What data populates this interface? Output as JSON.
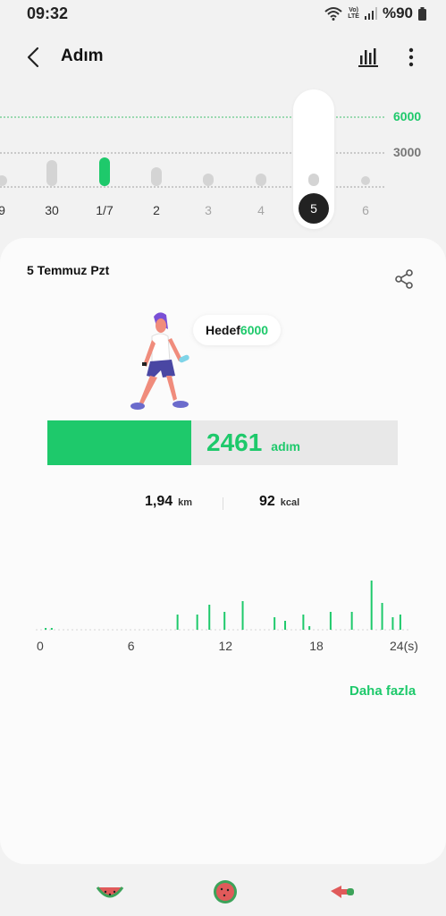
{
  "status": {
    "time": "09:32",
    "volte_top": "Vo)",
    "volte_bottom": "LTE",
    "battery": "%90"
  },
  "header": {
    "title": "Adım",
    "back_icon": "chevron-left-icon",
    "stats_icon": "bar-chart-icon",
    "menu_icon": "more-vertical-icon"
  },
  "week_chart": {
    "goal_label": "6000",
    "mid_label": "3000",
    "days": [
      {
        "label": "9",
        "steps": 900,
        "state": "past"
      },
      {
        "label": "30",
        "steps": 2200,
        "state": "past"
      },
      {
        "label": "1/7",
        "steps": 2500,
        "state": "goal"
      },
      {
        "label": "2",
        "steps": 1600,
        "state": "past"
      },
      {
        "label": "3",
        "steps": 1100,
        "state": "future"
      },
      {
        "label": "4",
        "steps": 1100,
        "state": "future"
      },
      {
        "label": "5",
        "steps": 1100,
        "state": "selected"
      },
      {
        "label": "6",
        "steps": 0,
        "state": "future"
      }
    ],
    "colors": {
      "goal": "#1ec96b",
      "bar": "#d4d4d4",
      "selected": "#222222"
    }
  },
  "day_card": {
    "date": "5 Temmuz Pzt",
    "share_icon": "share-icon",
    "goal_prefix": "Hedef",
    "goal_value": "6000",
    "steps": "2461",
    "steps_unit": "adım",
    "progress": 0.41,
    "distance": "1,94",
    "distance_unit": "km",
    "calories": "92",
    "calories_unit": "kcal",
    "more_label": "Daha fazla"
  },
  "hourly_chart": {
    "x_ticks": [
      "0",
      "6",
      "12",
      "18",
      "24(s)"
    ],
    "hours": [
      0.3,
      0.7,
      0,
      0,
      0,
      0,
      0,
      0,
      0,
      9,
      10.3,
      11.1,
      12.1,
      13.3,
      15.4,
      16.1,
      17.3,
      17.7,
      19.1,
      20.5,
      21.8,
      22.5,
      23.2,
      23.7
    ],
    "values": [
      2,
      2,
      0,
      0,
      0,
      0,
      0,
      0,
      0,
      17,
      17,
      28,
      20,
      32,
      14,
      10,
      17,
      4,
      20,
      20,
      55,
      30,
      14,
      17
    ]
  },
  "bottom_nav": [
    {
      "name": "watermelon-slice-icon"
    },
    {
      "name": "watermelon-round-icon"
    },
    {
      "name": "pointing-hand-icon"
    }
  ]
}
